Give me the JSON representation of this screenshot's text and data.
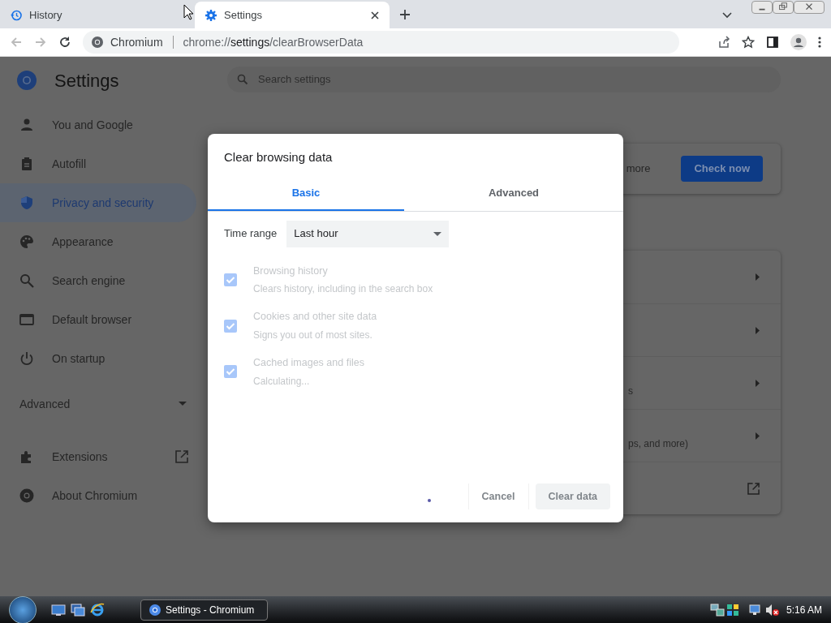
{
  "browser": {
    "tabs": [
      {
        "title": "History",
        "selected": false
      },
      {
        "title": "Settings",
        "selected": true
      }
    ],
    "address": {
      "site": "Chromium",
      "scheme": "chrome://",
      "host": "settings",
      "path": "/clearBrowserData"
    }
  },
  "settings": {
    "title": "Settings",
    "search": {
      "placeholder": "Search settings"
    },
    "nav": [
      {
        "label": "You and Google",
        "selected": false
      },
      {
        "label": "Autofill",
        "selected": false
      },
      {
        "label": "Privacy and security",
        "selected": true
      },
      {
        "label": "Appearance",
        "selected": false
      },
      {
        "label": "Search engine",
        "selected": false
      },
      {
        "label": "Default browser",
        "selected": false
      },
      {
        "label": "On startup",
        "selected": false
      }
    ],
    "advanced": "Advanced",
    "nav_bottom": [
      {
        "label": "Extensions"
      },
      {
        "label": "About Chromium"
      }
    ],
    "safety_check": {
      "text": "more",
      "button": "Check now"
    },
    "rows": [
      {
        "kind": "arrow"
      },
      {
        "kind": "arrow"
      },
      {
        "kind": "arrow",
        "text": "s"
      },
      {
        "kind": "arrow",
        "text": "ps, and more)"
      },
      {
        "kind": "external"
      }
    ]
  },
  "dialog": {
    "title": "Clear browsing data",
    "tabs": [
      {
        "label": "Basic",
        "selected": true
      },
      {
        "label": "Advanced",
        "selected": false
      }
    ],
    "time_range": {
      "label": "Time range",
      "value": "Last hour"
    },
    "items": [
      {
        "title": "Browsing history",
        "subtitle": "Clears history, including in the search box",
        "checked": true,
        "disabled": true
      },
      {
        "title": "Cookies and other site data",
        "subtitle": "Signs you out of most sites.",
        "checked": true,
        "disabled": true
      },
      {
        "title": "Cached images and files",
        "subtitle": "Calculating...",
        "checked": true,
        "disabled": true
      }
    ],
    "buttons": {
      "cancel": "Cancel",
      "confirm": "Clear data"
    }
  },
  "taskbar": {
    "window": "Settings - Chromium",
    "clock": "5:16 AM"
  }
}
